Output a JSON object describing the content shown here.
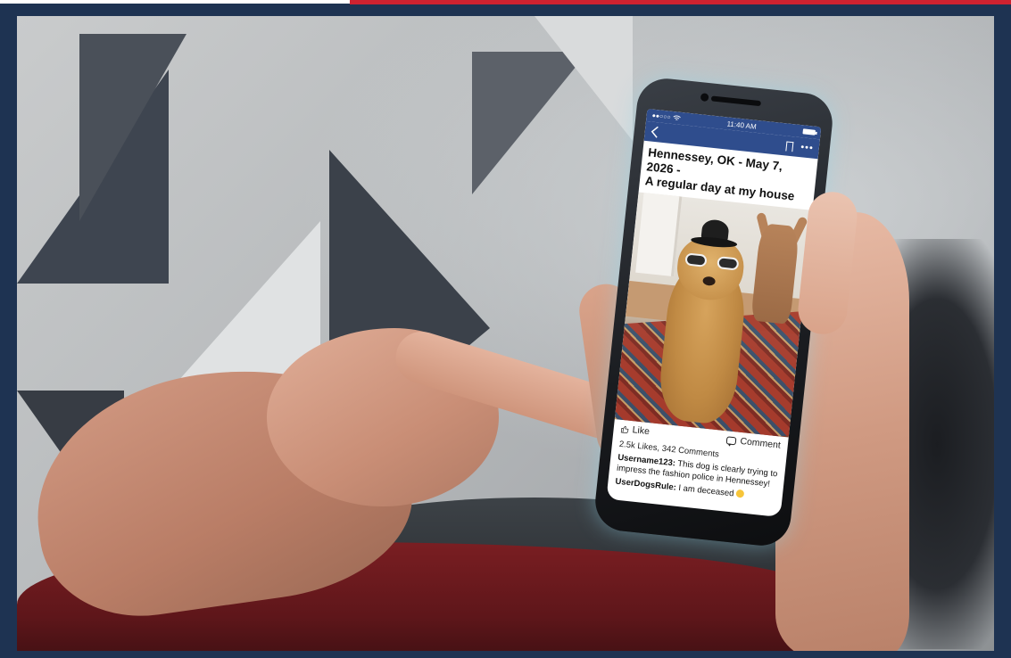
{
  "phone": {
    "status": {
      "carrier": "●●○○○",
      "time": "11:40 AM"
    },
    "nav": {
      "back_icon": "chevron-left-icon",
      "bookmark_icon": "bookmark-icon",
      "more_label": "•••"
    },
    "post": {
      "title_line1": "Hennessey, OK - May 7, 2026 -",
      "title_line2": "A regular day at my house",
      "actions": {
        "like_label": "Like",
        "comment_label": "Comment"
      },
      "counts": "2.5k Likes, 342 Comments",
      "comments": [
        {
          "user": "Username123:",
          "text": " This dog is clearly trying to impress the fashion police in Hennessey!"
        },
        {
          "user": "UserDogsRule:",
          "text": " I am deceased"
        }
      ]
    }
  },
  "colors": {
    "frame": "#1e3352",
    "accent": "#cf2230",
    "app_bar": "#2f4d8d"
  }
}
